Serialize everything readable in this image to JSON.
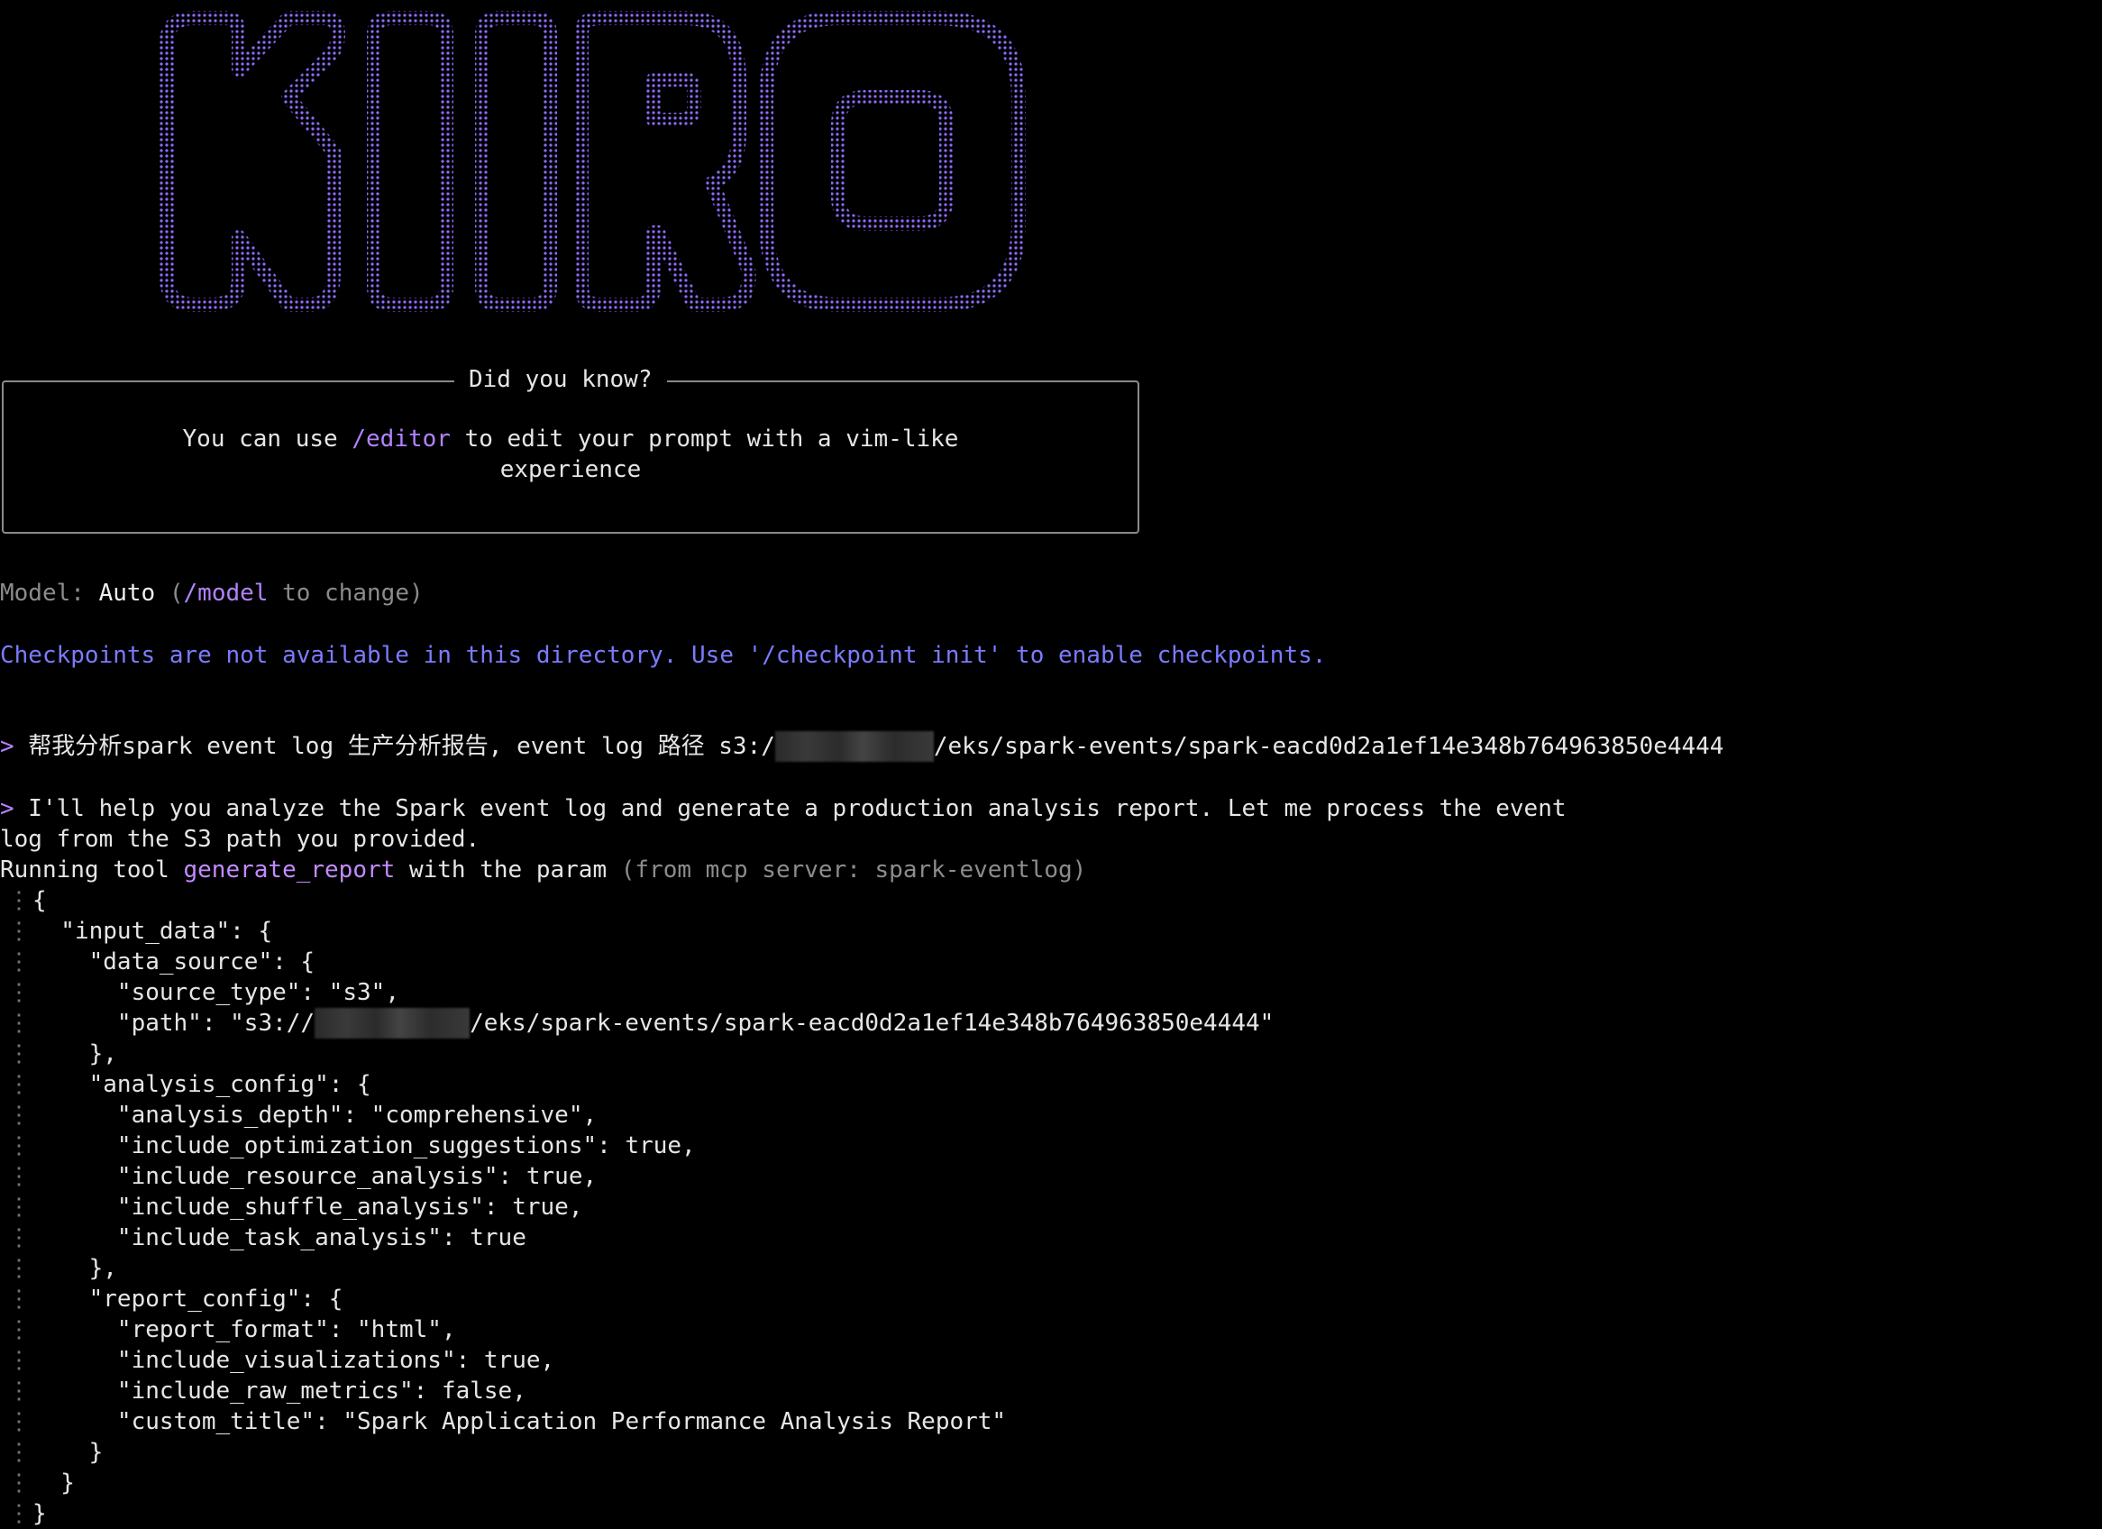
{
  "logo": {
    "text": "KIRO",
    "color": "#8f6bff"
  },
  "tip": {
    "title": "Did you know?",
    "line1_prefix": "You can use ",
    "line1_command": "/editor",
    "line1_suffix": " to edit your prompt with a vim-like",
    "line2": "experience"
  },
  "model": {
    "label": "Model: ",
    "value": "Auto",
    "open_paren": " (",
    "command": "/model",
    "hint": " to change)"
  },
  "checkpoint_notice": "Checkpoints are not available in this directory. Use '/checkpoint init' to enable checkpoints.",
  "user_prompt": {
    "arrow": ">",
    "text_before": " 帮我分析spark event log 生产分析报告, event log 路径 s3:/",
    "text_after": "/eks/spark-events/spark-eacd0d2a1ef14e348b764963850e4444"
  },
  "assistant": {
    "arrow": ">",
    "line1": " I'll help you analyze the Spark event log and generate a production analysis report. Let me process the event",
    "line2": "log from the S3 path you provided.",
    "tool_prefix": "Running tool ",
    "tool_name": "generate_report",
    "tool_middle": " with the param ",
    "tool_source": "(from mcp server: spark-eventlog)"
  },
  "code": {
    "gutter_char": "⋮",
    "lines": [
      "{",
      "  \"input_data\": {",
      "    \"data_source\": {",
      "      \"source_type\": \"s3\",",
      "      \"path\": \"s3://",
      "    },",
      "    \"analysis_config\": {",
      "      \"analysis_depth\": \"comprehensive\",",
      "      \"include_optimization_suggestions\": true,",
      "      \"include_resource_analysis\": true,",
      "      \"include_shuffle_analysis\": true,",
      "      \"include_task_analysis\": true",
      "    },",
      "    \"report_config\": {",
      "      \"report_format\": \"html\",",
      "      \"include_visualizations\": true,",
      "      \"include_raw_metrics\": false,",
      "      \"custom_title\": \"Spark Application Performance Analysis Report\"",
      "    }",
      "  }",
      "}"
    ],
    "path_suffix": "/eks/spark-events/spark-eacd0d2a1ef14e348b764963850e4444\""
  }
}
